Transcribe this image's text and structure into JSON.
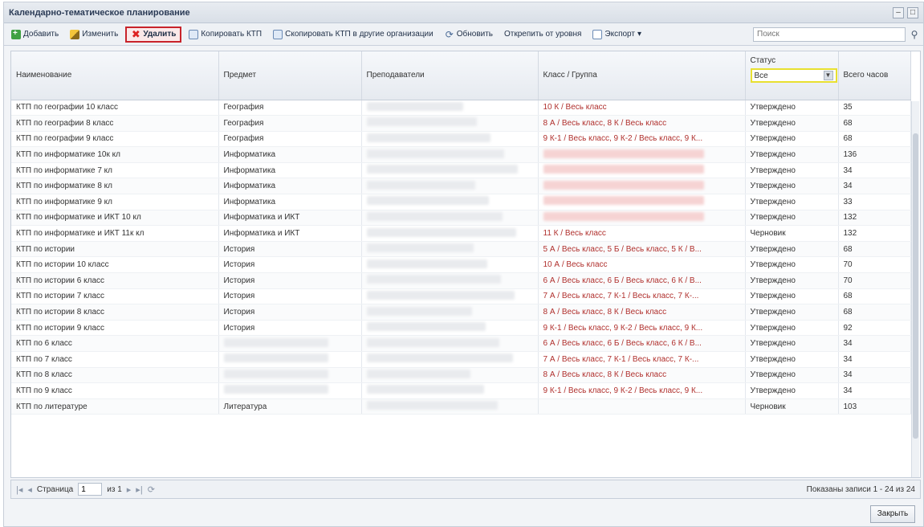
{
  "window": {
    "title": "Календарно-тематическое планирование"
  },
  "toolbar": {
    "add": "Добавить",
    "edit": "Изменить",
    "delete": "Удалить",
    "copy_ktp": "Копировать КТП",
    "copy_ktp_other": "Скопировать КТП в другие организации",
    "refresh": "Обновить",
    "detach": "Открепить от уровня",
    "export": "Экспорт",
    "search_placeholder": "Поиск"
  },
  "columns": [
    "Наименование",
    "Предмет",
    "Преподаватели",
    "Класс / Группа",
    "Статус",
    "Всего часов"
  ],
  "status_filter": {
    "value": "Все"
  },
  "rows": [
    {
      "name": "КТП по географии 10 класс",
      "subject": "География",
      "klass": "10 К / Весь класс",
      "status": "Утверждено",
      "hours": "35"
    },
    {
      "name": "КТП по географии 8 класс",
      "subject": "География",
      "klass": "8 А / Весь класс, 8 К / Весь класс",
      "status": "Утверждено",
      "hours": "68"
    },
    {
      "name": "КТП по географии 9 класс",
      "subject": "География",
      "klass": "9 К-1 / Весь класс, 9 К-2 / Весь класс, 9 К...",
      "status": "Утверждено",
      "hours": "68"
    },
    {
      "name": "КТП по информатике 10к кл",
      "subject": "Информатика",
      "klass": "",
      "status": "Утверждено",
      "hours": "136"
    },
    {
      "name": "КТП по информатике 7 кл",
      "subject": "Информатика",
      "klass": "",
      "status": "Утверждено",
      "hours": "34"
    },
    {
      "name": "КТП по информатике 8 кл",
      "subject": "Информатика",
      "klass": "",
      "status": "Утверждено",
      "hours": "34"
    },
    {
      "name": "КТП по информатике 9 кл",
      "subject": "Информатика",
      "klass": "",
      "status": "Утверждено",
      "hours": "33"
    },
    {
      "name": "КТП по информатике и ИКТ 10 кл",
      "subject": "Информатика и ИКТ",
      "klass": "",
      "status": "Утверждено",
      "hours": "132"
    },
    {
      "name": "КТП по информатике и ИКТ 11к кл",
      "subject": "Информатика и ИКТ",
      "klass": "11 К / Весь класс",
      "status": "Черновик",
      "hours": "132"
    },
    {
      "name": "КТП по истории",
      "subject": "История",
      "klass": "5 А / Весь класс, 5 Б / Весь класс, 5 К / В...",
      "status": "Утверждено",
      "hours": "68"
    },
    {
      "name": "КТП по истории 10 класс",
      "subject": "История",
      "klass": "10 А / Весь класс",
      "status": "Утверждено",
      "hours": "70"
    },
    {
      "name": "КТП по истории 6 класс",
      "subject": "История",
      "klass": "6 А / Весь класс, 6 Б / Весь класс, 6 К / В...",
      "status": "Утверждено",
      "hours": "70"
    },
    {
      "name": "КТП по истории 7 класс",
      "subject": "История",
      "klass": "7 А / Весь класс, 7 К-1 / Весь класс, 7 К-...",
      "status": "Утверждено",
      "hours": "68"
    },
    {
      "name": "КТП по истории 8 класс",
      "subject": "История",
      "klass": "8 А / Весь класс, 8 К / Весь класс",
      "status": "Утверждено",
      "hours": "68"
    },
    {
      "name": "КТП по истории 9 класс",
      "subject": "История",
      "klass": "9 К-1 / Весь класс, 9 К-2 / Весь класс, 9 К...",
      "status": "Утверждено",
      "hours": "92"
    },
    {
      "name": "КТП по                                6 класс",
      "subject": "",
      "klass": "6 А / Весь класс, 6 Б / Весь класс, 6 К / В...",
      "status": "Утверждено",
      "hours": "34"
    },
    {
      "name": "КТП по                                7 класс",
      "subject": "",
      "klass": "7 А / Весь класс, 7 К-1 / Весь класс, 7 К-...",
      "status": "Утверждено",
      "hours": "34"
    },
    {
      "name": "КТП по                                8 класс",
      "subject": "",
      "klass": "8 А / Весь класс, 8 К / Весь класс",
      "status": "Утверждено",
      "hours": "34"
    },
    {
      "name": "КТП по                                9 класс",
      "subject": "",
      "klass": "9 К-1 / Весь класс, 9 К-2 / Весь класс, 9 К...",
      "status": "Утверждено",
      "hours": "34"
    },
    {
      "name": "КТП по литературе",
      "subject": "Литература",
      "klass": "",
      "status": "Черновик",
      "hours": "103"
    }
  ],
  "pager": {
    "page_label": "Страница",
    "page_value": "1",
    "of_label": "из 1",
    "info": "Показаны записи 1 - 24 из 24"
  },
  "footer": {
    "close": "Закрыть"
  }
}
